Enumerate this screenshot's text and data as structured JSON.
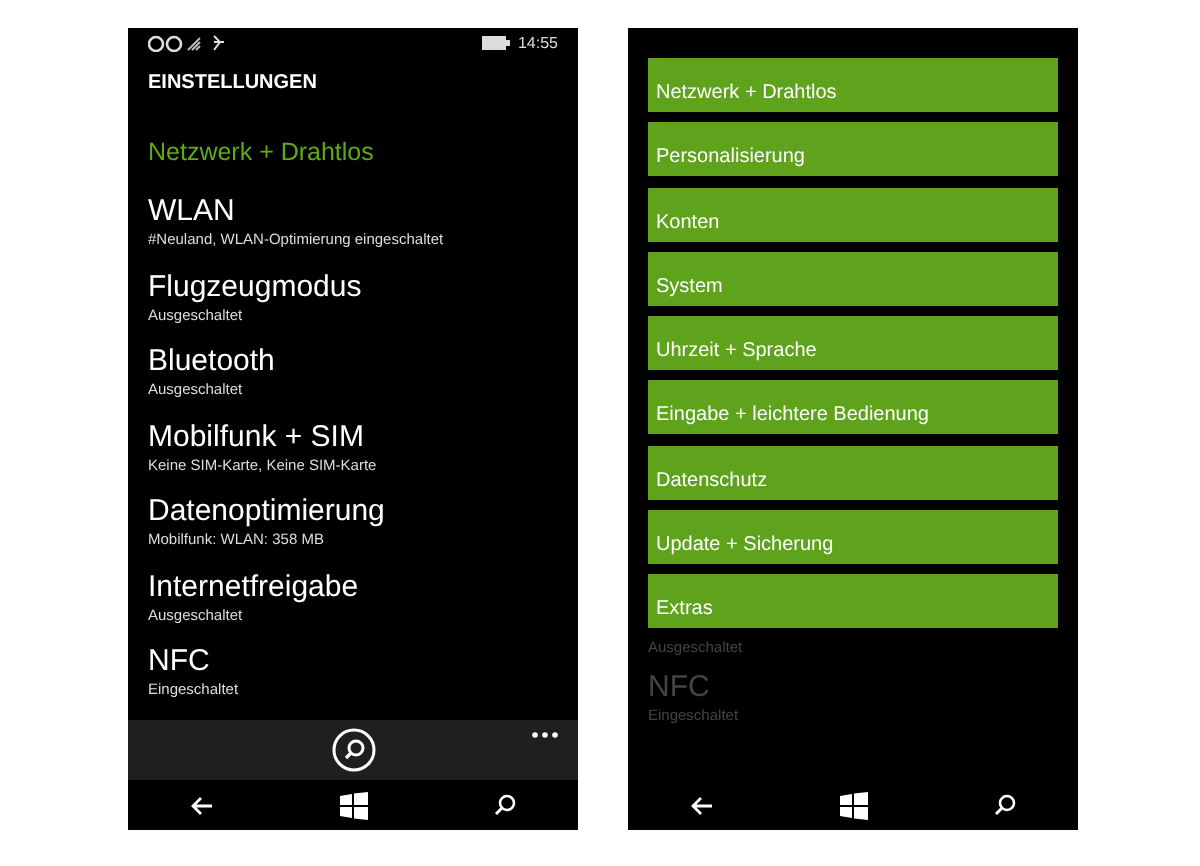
{
  "left_screen": {
    "status_bar": {
      "time": "14:55"
    },
    "title": "EINSTELLUNGEN",
    "section": "Netzwerk + Drahtlos",
    "items": [
      {
        "title": "WLAN",
        "subtitle": "#Neuland, WLAN-Optimierung eingeschaltet"
      },
      {
        "title": "Flugzeugmodus",
        "subtitle": "Ausgeschaltet"
      },
      {
        "title": "Bluetooth",
        "subtitle": "Ausgeschaltet"
      },
      {
        "title": "Mobilfunk + SIM",
        "subtitle": "Keine SIM-Karte, Keine SIM-Karte"
      },
      {
        "title": "Datenoptimierung",
        "subtitle": "Mobilfunk:  WLAN: 358 MB"
      },
      {
        "title": "Internetfreigabe",
        "subtitle": "Ausgeschaltet"
      },
      {
        "title": "NFC",
        "subtitle": "Eingeschaltet"
      }
    ]
  },
  "right_screen": {
    "menu": [
      {
        "label": "Netzwerk + Drahtlos"
      },
      {
        "label": "Personalisierung"
      },
      {
        "label": "Konten"
      },
      {
        "label": "System"
      },
      {
        "label": "Uhrzeit + Sprache"
      },
      {
        "label": "Eingabe + leichtere Bedienung"
      },
      {
        "label": "Datenschutz"
      },
      {
        "label": "Update + Sicherung"
      },
      {
        "label": "Extras"
      }
    ],
    "background_items": [
      {
        "kind": "subtitle",
        "text": "Ausgeschaltet"
      },
      {
        "kind": "title",
        "text": "NFC"
      },
      {
        "kind": "subtitle",
        "text": "Eingeschaltet"
      }
    ]
  }
}
